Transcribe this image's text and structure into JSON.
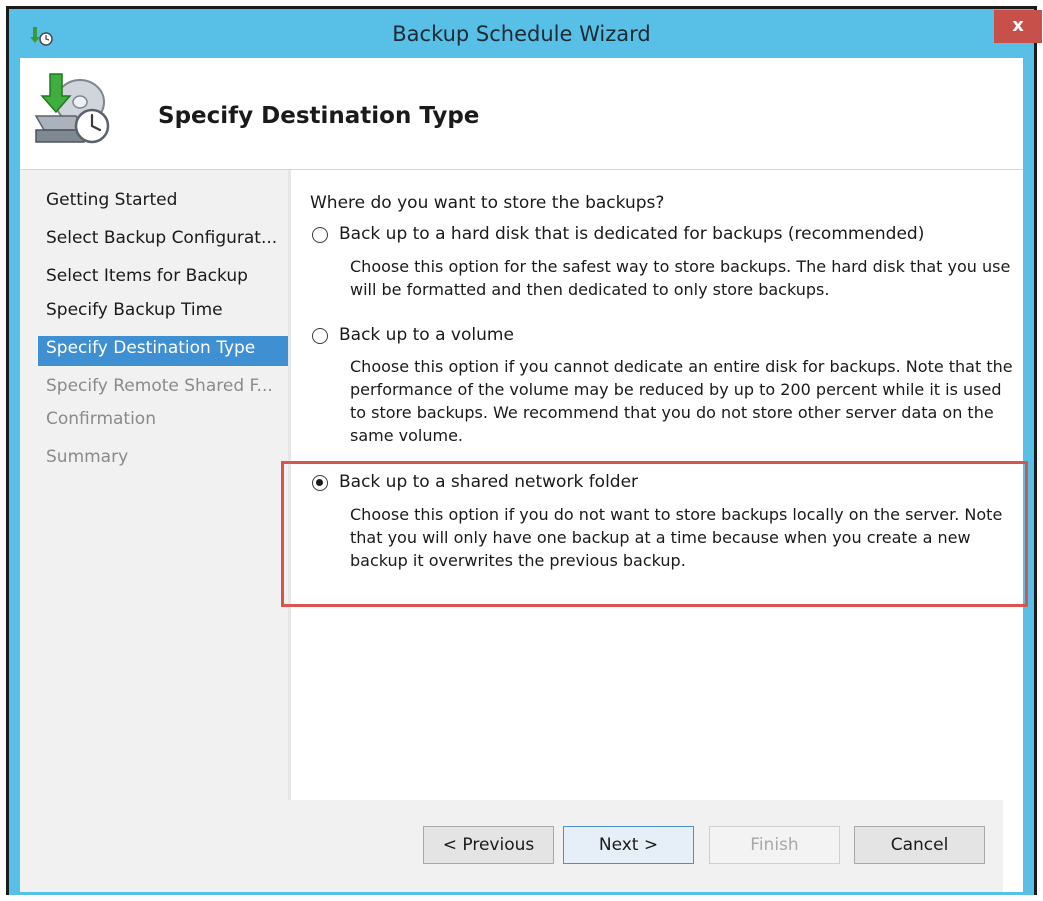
{
  "window": {
    "title": "Backup Schedule Wizard",
    "close_label": "x",
    "app_icon": "backup-app-icon"
  },
  "header": {
    "title": "Specify Destination Type",
    "icon": "backup-drive-clock-icon"
  },
  "nav": {
    "items": [
      {
        "label": "Getting Started",
        "state": "normal"
      },
      {
        "label": "Select Backup Configurat...",
        "state": "normal"
      },
      {
        "label": "Select Items for Backup",
        "state": "normal"
      },
      {
        "label": "Specify Backup Time",
        "state": "normal"
      },
      {
        "label": "Specify Destination Type",
        "state": "selected"
      },
      {
        "label": "Specify Remote Shared F...",
        "state": "disabled"
      },
      {
        "label": "Confirmation",
        "state": "disabled"
      },
      {
        "label": "Summary",
        "state": "disabled"
      }
    ]
  },
  "main": {
    "question": "Where do you want to store the backups?",
    "options": [
      {
        "label": "Back up to a hard disk that is dedicated for backups (recommended)",
        "description": "Choose this option for the safest way to store backups. The hard disk that you use will be formatted and then dedicated to only store backups.",
        "selected": false
      },
      {
        "label": "Back up to a volume",
        "description": "Choose this option if you cannot dedicate an entire disk for backups. Note that the performance of the volume may be reduced by up to 200 percent while it is used to store backups. We recommend that you do not store other server data on the same volume.",
        "selected": false
      },
      {
        "label": "Back up to a shared network folder",
        "description": "Choose this option if you do not want to store backups locally on the server. Note that you will only have one backup at a time because when you create a new backup it overwrites the previous backup.",
        "selected": true
      }
    ]
  },
  "buttons": {
    "previous": "< Previous",
    "next": "Next >",
    "finish": "Finish",
    "cancel": "Cancel"
  },
  "colors": {
    "titlebar": "#58bfe6",
    "close": "#c7504a",
    "nav_selected": "#3f8fd3",
    "highlight": "#d9534f"
  }
}
